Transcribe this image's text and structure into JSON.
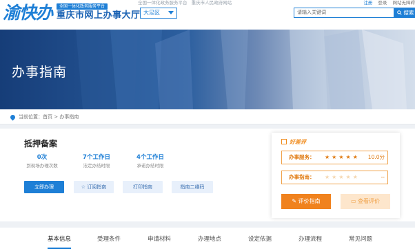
{
  "header": {
    "logo_mark": "渝快办",
    "logo_platform": "全国一体化政务服务平台",
    "logo_hall": "重庆市网上办事大厅",
    "top_links": [
      "全国一体化政务服务平台",
      "重庆市人民政府网站"
    ],
    "region": "大足区",
    "user_links": [
      "注册",
      "登录",
      "网站无障碍"
    ],
    "search_placeholder": "请输入关键词",
    "search_button": "搜索"
  },
  "banner": {
    "title": "办事指南"
  },
  "breadcrumb": {
    "text": "当前位置：首页 > 办事指南"
  },
  "service": {
    "title": "抵押备案",
    "stats": [
      {
        "value": "0次",
        "label": "到现场办理次数"
      },
      {
        "value": "7个工作日",
        "label": "法定办结时限"
      },
      {
        "value": "4个工作日",
        "label": "承诺办结时限"
      }
    ],
    "actions": [
      "立即办理",
      "订阅指南",
      "打印指南",
      "指南二维码"
    ]
  },
  "review": {
    "title": "好差评",
    "service_label": "办事服务：",
    "service_stars": 5,
    "service_score": "10.0分",
    "guide_label": "办事指南：",
    "guide_stars": 0,
    "guide_score": "--",
    "eval_button": "评价指南",
    "view_button": "查看评价",
    "colors": {
      "accent": "#f0821e",
      "star_on": "#e07a10",
      "star_off": "#f5d7b0"
    }
  },
  "tabs": [
    "基本信息",
    "受理条件",
    "申请材料",
    "办理地点",
    "设定依据",
    "办理流程",
    "常见问题"
  ],
  "active_tab": "基本信息",
  "colors": {
    "brand": "#1e7fd6"
  }
}
